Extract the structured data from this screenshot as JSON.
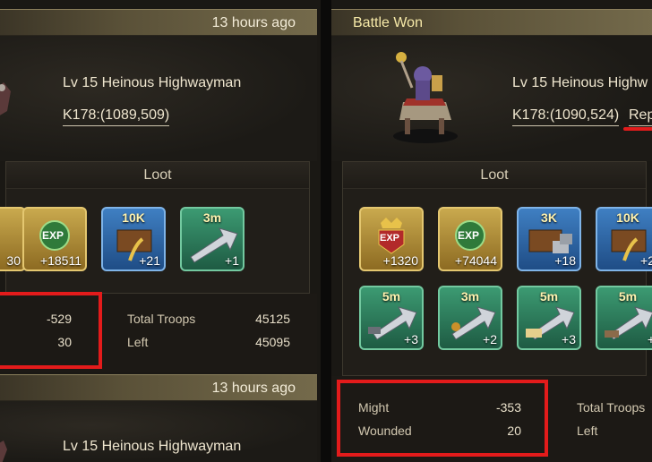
{
  "left": {
    "header_time": "13 hours ago",
    "enemy_name": "Lv 15 Heinous Highwayman",
    "coords": "K178:(1089,509)",
    "loot_title": "Loot",
    "loot_items": [
      {
        "icon": "partial-item",
        "count": "30"
      },
      {
        "icon": "exp-icon",
        "label": "EXP",
        "count": "+18511"
      },
      {
        "icon": "grain-chest-icon",
        "top": "10K",
        "count": "+21"
      },
      {
        "icon": "speedup-arrow-icon",
        "top": "3m",
        "count": "+1"
      }
    ],
    "stats": {
      "might_value": "-529",
      "wounded_value": "30",
      "total_troops_label": "Total Troops",
      "total_troops_value": "45125",
      "left_label": "Left",
      "left_value": "45095"
    },
    "header2_time": "13 hours ago",
    "enemy2_name": "Lv 15 Heinous Highwayman"
  },
  "right": {
    "header_title": "Battle Won",
    "enemy_name": "Lv 15 Heinous Highw",
    "coords": "K178:(1090,524)",
    "report_link": "Rep",
    "loot_title": "Loot",
    "loot_row1": [
      {
        "icon": "exp-crown-icon",
        "label": "EXP",
        "count": "+1320"
      },
      {
        "icon": "exp-icon",
        "label": "EXP",
        "count": "+74044"
      },
      {
        "icon": "stone-chest-icon",
        "top": "3K",
        "count": "+18"
      },
      {
        "icon": "grain-chest-icon",
        "top": "10K",
        "count": "+2"
      }
    ],
    "loot_row2": [
      {
        "icon": "speedup-hammer-icon",
        "top": "5m",
        "count": "+3"
      },
      {
        "icon": "speedup-soldier-icon",
        "top": "3m",
        "count": "+2"
      },
      {
        "icon": "speedup-scroll-icon",
        "top": "5m",
        "count": "+3"
      },
      {
        "icon": "speedup-boot-icon",
        "top": "5m",
        "count": "+"
      }
    ],
    "stats": {
      "might_label": "Might",
      "might_value": "-353",
      "wounded_label": "Wounded",
      "wounded_value": "20",
      "total_troops_label": "Total Troops",
      "left_label": "Left"
    }
  },
  "colors": {
    "header_gold": "#746a4b",
    "highlight_red": "#e31b1b",
    "title_yellow": "#f6e9a8"
  }
}
